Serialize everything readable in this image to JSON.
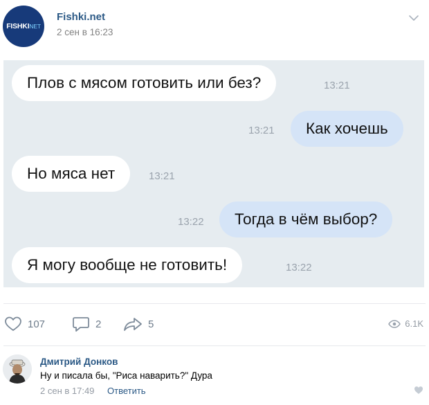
{
  "post": {
    "author": "Fishki.net",
    "date": "2 сен в 16:23",
    "logo": {
      "main": "FISHKI",
      "suffix": "NET"
    }
  },
  "chat": {
    "messages": [
      {
        "side": "in",
        "text": "Плов с мясом готовить или без?",
        "time": "13:21"
      },
      {
        "side": "out",
        "text": "Как хочешь",
        "time": "13:21"
      },
      {
        "side": "in",
        "text": "Но мяса нет",
        "time": "13:21"
      },
      {
        "side": "out",
        "text": "Тогда в чём выбор?",
        "time": "13:22"
      },
      {
        "side": "in",
        "text": "Я могу вообще не готовить!",
        "time": "13:22"
      }
    ]
  },
  "actions": {
    "likes": "107",
    "comments": "2",
    "shares": "5",
    "views": "6.1K"
  },
  "comment": {
    "author": "Дмитрий Донков",
    "text": "Ну и писала бы, \"Риса наварить?\" Дура",
    "date": "2 сен в 17:49",
    "reply_label": "Ответить"
  },
  "colors": {
    "link": "#2a5885",
    "chat_background": "#e6ecf0",
    "outgoing_bubble": "#d5e4f7",
    "logo_background": "#173a7a"
  },
  "icons": [
    "chevron-down-icon",
    "heart-icon",
    "comment-icon",
    "share-icon",
    "eye-icon",
    "heart-small-icon"
  ]
}
